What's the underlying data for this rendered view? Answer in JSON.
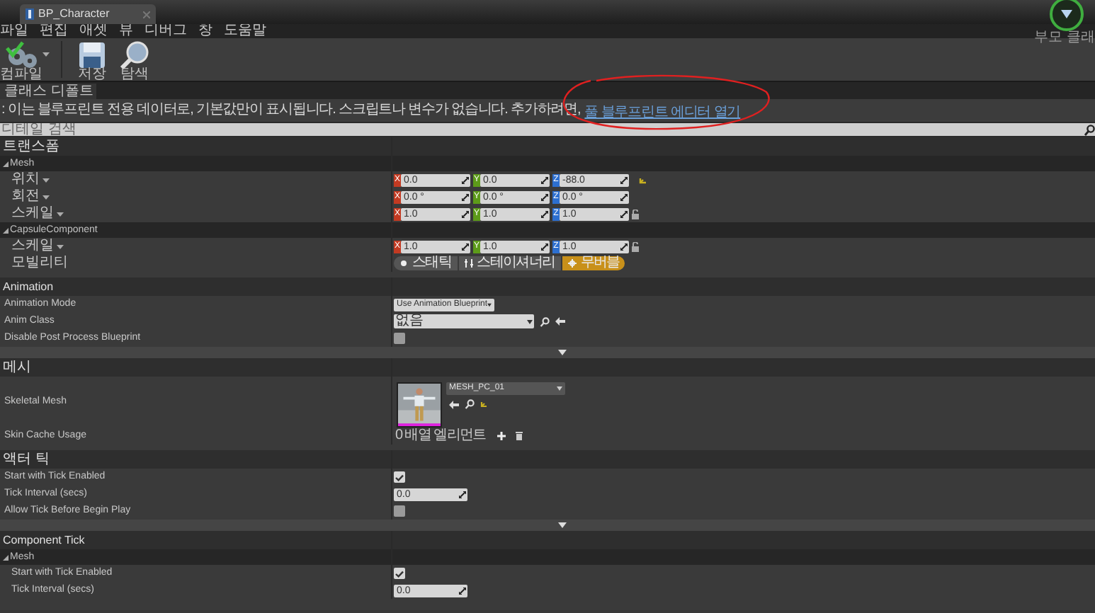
{
  "window": {
    "tab_title": "BP_Character",
    "parent_class_label": "부모 클래"
  },
  "menu": [
    "파일",
    "편집",
    "애셋",
    "뷰",
    "디버그",
    "창",
    "도움말"
  ],
  "toolbar": [
    {
      "kind": "compile",
      "label": "컴파일"
    },
    {
      "kind": "save",
      "label": "저장"
    },
    {
      "kind": "browse",
      "label": "탐색"
    }
  ],
  "panel_tab": {
    "title": "클래스 디폴트"
  },
  "notice": {
    "text": ": 이는 블루프린트 전용 데이터로, 기본값만이 표시됩니다. 스크립트나 변수가 없습니다. 추가하려면,",
    "link": "풀 블루프린트 에디터 열기"
  },
  "search": {
    "placeholder": "디테일 검색"
  },
  "sections": [
    {
      "title": "트랜스폼",
      "expander": false,
      "rows": [
        {
          "kind": "subcategory",
          "label": "Mesh"
        },
        {
          "kind": "vector",
          "label": "위치",
          "components": [
            {
              "axis": "X",
              "value": "0.0"
            },
            {
              "axis": "Y",
              "value": "0.0"
            },
            {
              "axis": "Z",
              "value": "-88.0"
            }
          ],
          "reset": true,
          "lock": false
        },
        {
          "kind": "vector",
          "label": "회전",
          "components": [
            {
              "axis": "X",
              "value": "0.0 °"
            },
            {
              "axis": "Y",
              "value": "0.0 °"
            },
            {
              "axis": "Z",
              "value": "0.0 °"
            }
          ],
          "reset": false,
          "lock": false
        },
        {
          "kind": "vector",
          "label": "스케일",
          "components": [
            {
              "axis": "X",
              "value": "1.0"
            },
            {
              "axis": "Y",
              "value": "1.0"
            },
            {
              "axis": "Z",
              "value": "1.0"
            }
          ],
          "reset": false,
          "lock": true
        },
        {
          "kind": "subcategory",
          "label": "CapsuleComponent"
        },
        {
          "kind": "vector",
          "label": "스케일",
          "components": [
            {
              "axis": "X",
              "value": "1.0"
            },
            {
              "axis": "Y",
              "value": "1.0"
            },
            {
              "axis": "Z",
              "value": "1.0"
            }
          ],
          "reset": false,
          "lock": true
        },
        {
          "kind": "mobility",
          "label": "모빌리티",
          "options": [
            {
              "label": "스태틱",
              "selected": false
            },
            {
              "label": "스테이셔너리",
              "selected": false
            },
            {
              "label": "무버블",
              "selected": true
            }
          ]
        }
      ]
    },
    {
      "title": "Animation",
      "expander": true,
      "rows": [
        {
          "kind": "dropdown",
          "label": "Animation Mode",
          "value": "Use Animation Blueprint"
        },
        {
          "kind": "class_picker",
          "label": "Anim Class",
          "value": "없음"
        },
        {
          "kind": "checkbox",
          "label": "Disable Post Process Blueprint",
          "checked": false
        }
      ]
    },
    {
      "title": "메시",
      "expander": false,
      "rows": [
        {
          "kind": "mesh",
          "label": "Skeletal Mesh",
          "value": "MESH_PC_01"
        },
        {
          "kind": "array",
          "label": "Skin Cache Usage",
          "value": "0 배열 엘리먼트"
        }
      ]
    },
    {
      "title": "액터 틱",
      "expander": true,
      "rows": [
        {
          "kind": "checkbox",
          "label": "Start with Tick Enabled",
          "checked": true
        },
        {
          "kind": "number",
          "label": "Tick Interval (secs)",
          "value": "0.0"
        },
        {
          "kind": "checkbox",
          "label": "Allow Tick Before Begin Play",
          "checked": false
        }
      ]
    },
    {
      "title": "Component Tick",
      "expander": false,
      "rows": [
        {
          "kind": "subcategory",
          "label": "Mesh"
        },
        {
          "kind": "checkbox",
          "label": "Start with Tick Enabled",
          "checked": true
        },
        {
          "kind": "number",
          "label": "Tick Interval (secs)",
          "value": "0.0"
        }
      ]
    }
  ]
}
